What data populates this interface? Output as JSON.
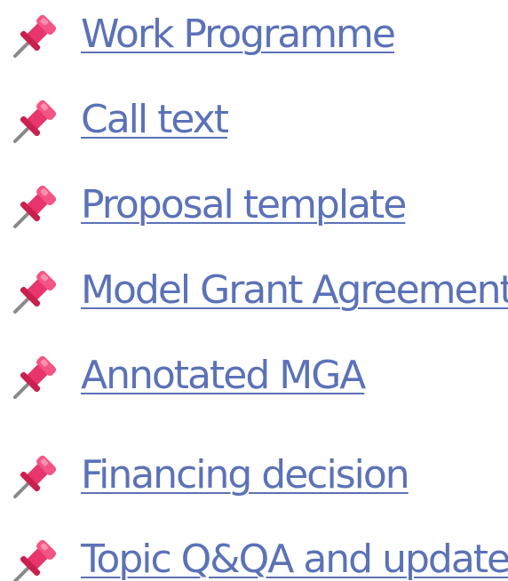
{
  "links": [
    {
      "label": "Work Programme",
      "icon": "pushpin-icon"
    },
    {
      "label": "Call text",
      "icon": "pushpin-icon"
    },
    {
      "label": "Proposal template",
      "icon": "pushpin-icon"
    },
    {
      "label": "Model Grant Agreement (",
      "icon": "pushpin-icon"
    },
    {
      "label": "Annotated MGA",
      "icon": "pushpin-icon"
    },
    {
      "label": "Financing decision",
      "icon": "pushpin-icon"
    },
    {
      "label": "Topic Q&QA and updates",
      "icon": "pushpin-icon"
    }
  ],
  "colors": {
    "link": "#5b72b8",
    "pin_head": "#e8356b",
    "pin_needle": "#8a8a8a"
  }
}
